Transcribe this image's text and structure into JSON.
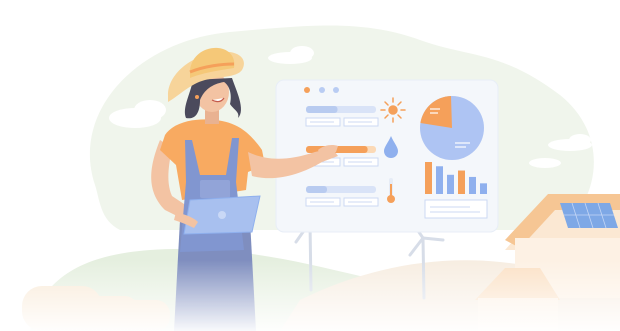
{
  "palette": {
    "background": "#ffffff",
    "blob": "#f0f5ec",
    "hills": "#e5efdf",
    "field": "#f7ede1",
    "panel": "#f4f7fb",
    "panel_line": "#ccd9f3",
    "accent_orange": "#f5a05a",
    "accent_blue": "#8fb0ee",
    "shirt": "#f8aa61",
    "overalls": "#8196d0",
    "hat": "#f7d49a",
    "hair": "#4b4a5c",
    "skin": "#f3c3a3",
    "roof": "#f6c694",
    "solar": "#7ea8e6",
    "turbine": "#d7dde8"
  },
  "icons": {
    "sun": "sun-icon",
    "water": "water-drop-icon",
    "temperature": "thermometer-icon",
    "pie": "pie-chart-icon",
    "bars": "bar-chart-icon"
  },
  "dashboard_levels": {
    "slider_1": 0.45,
    "slider_2": 0.88,
    "slider_3": 0.3
  },
  "chart_data": {
    "type": "bar",
    "categories": [
      "",
      "",
      "",
      "",
      "",
      ""
    ],
    "values": [
      30,
      26,
      18,
      22,
      16,
      10
    ]
  },
  "pie_share": 0.22
}
